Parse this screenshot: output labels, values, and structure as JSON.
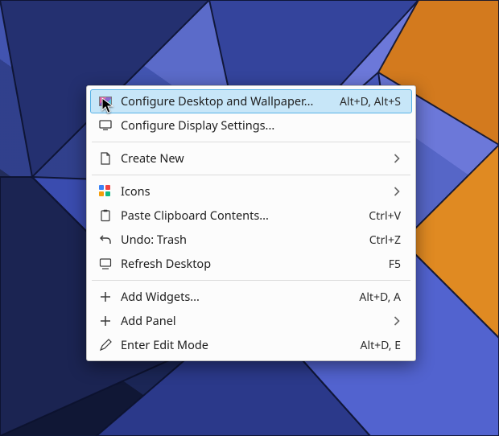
{
  "menu": {
    "items": [
      {
        "label": "Configure Desktop and Wallpaper...",
        "shortcut": "Alt+D, Alt+S"
      },
      {
        "label": "Configure Display Settings...",
        "shortcut": ""
      },
      {
        "label": "Create New",
        "shortcut": ""
      },
      {
        "label": "Icons",
        "shortcut": ""
      },
      {
        "label": "Paste Clipboard Contents...",
        "shortcut": "Ctrl+V"
      },
      {
        "label": "Undo: Trash",
        "shortcut": "Ctrl+Z"
      },
      {
        "label": "Refresh Desktop",
        "shortcut": "F5"
      },
      {
        "label": "Add Widgets...",
        "shortcut": "Alt+D, A"
      },
      {
        "label": "Add Panel",
        "shortcut": ""
      },
      {
        "label": "Enter Edit Mode",
        "shortcut": "Alt+D, E"
      }
    ]
  }
}
